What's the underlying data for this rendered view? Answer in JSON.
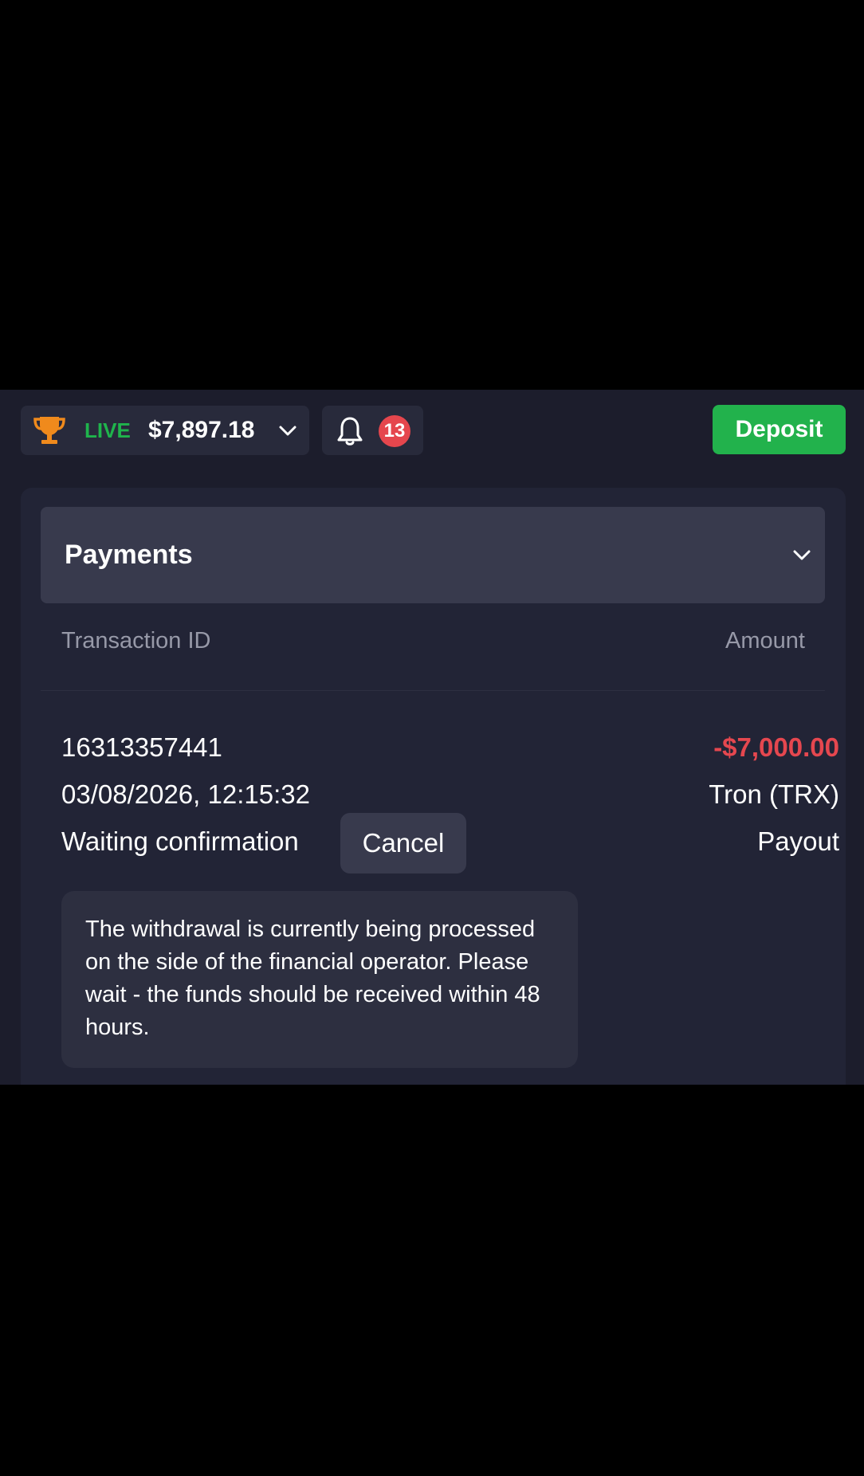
{
  "topbar": {
    "account_type": "LIVE",
    "balance": "$7,897.18",
    "notifications_count": "13",
    "deposit_label": "Deposit"
  },
  "payments": {
    "title": "Payments",
    "columns": {
      "transaction_id": "Transaction ID",
      "amount": "Amount"
    },
    "transaction": {
      "id": "16313357441",
      "datetime": "03/08/2026, 12:15:32",
      "status": "Waiting confirmation",
      "cancel_label": "Cancel",
      "amount": "-$7,000.00",
      "method": "Tron (TRX)",
      "type": "Payout",
      "info": "The withdrawal is currently being processed on the side of the financial operator. Please wait - the funds should be received within 48 hours."
    }
  },
  "colors": {
    "live": "#1fb44c",
    "deposit": "#22b24c",
    "negative_amount": "#e5474f",
    "badge": "#e5464d",
    "trophy": "#f08a1c"
  },
  "icons": {
    "trophy": "trophy-icon",
    "balance_dropdown": "chevron-down-icon",
    "notifications": "bell-icon",
    "payments_toggle": "chevron-down-icon"
  }
}
